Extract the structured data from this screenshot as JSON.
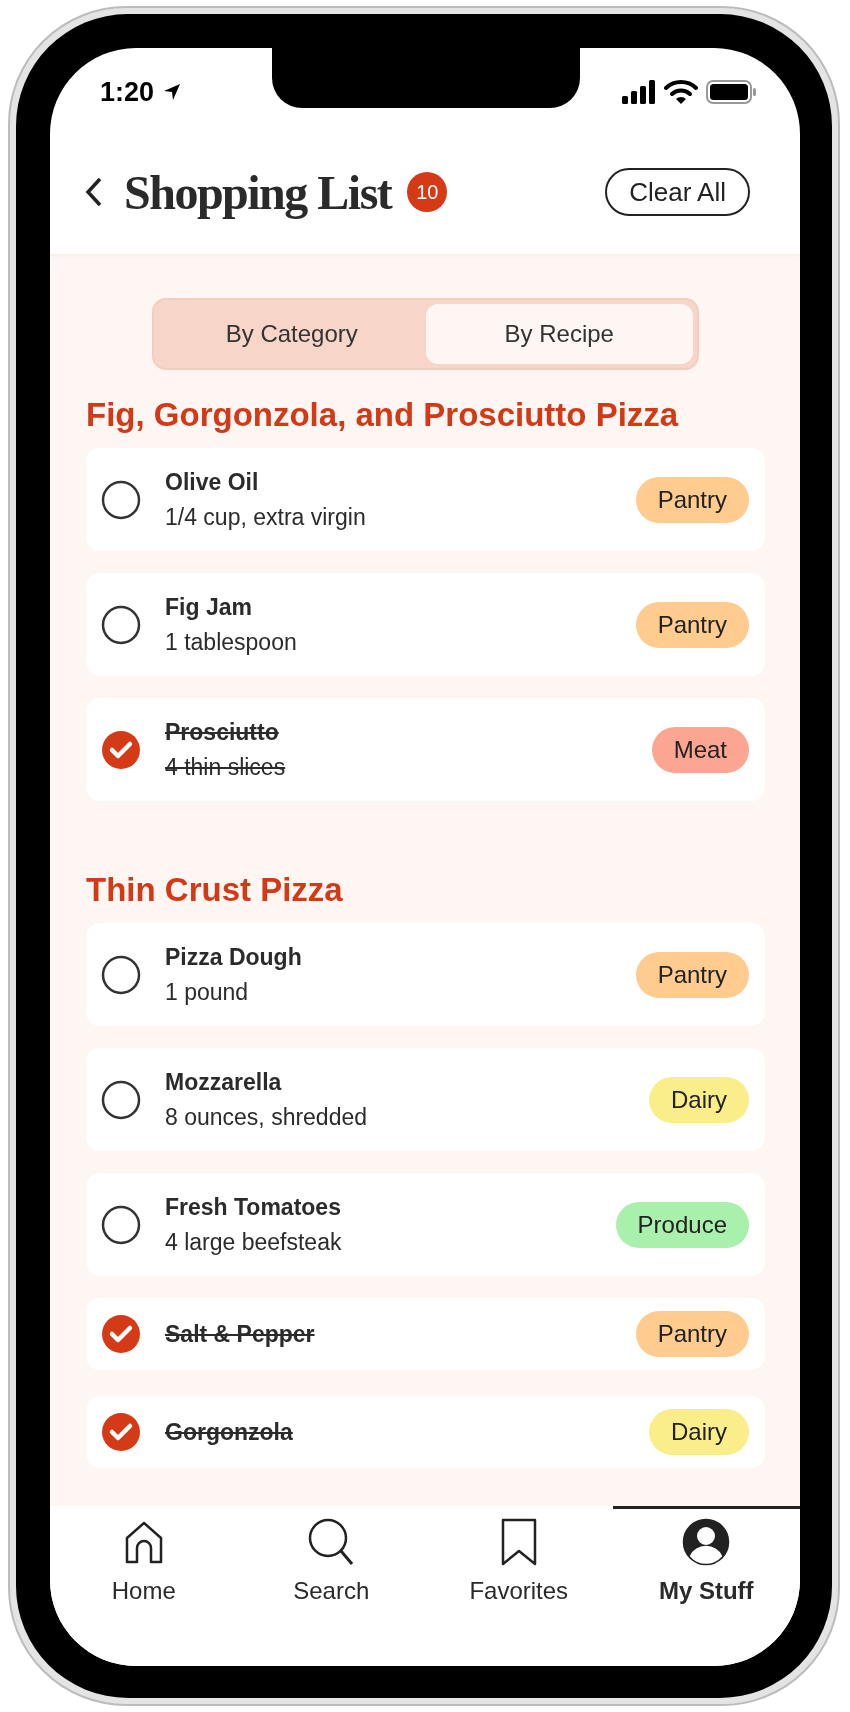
{
  "status_bar": {
    "time": "1:20"
  },
  "header": {
    "title": "Shopping List",
    "count": "10",
    "action": "Clear All"
  },
  "view_tabs": [
    {
      "label": "By Category",
      "selected": false
    },
    {
      "label": "By Recipe",
      "selected": true
    }
  ],
  "sections": [
    {
      "title": "Fig, Gorgonzola, and Prosciutto Pizza",
      "items": [
        {
          "name": "Olive Oil",
          "detail": "1/4 cup, extra virgin",
          "tag": "Pantry",
          "color": "#ffcb8e",
          "checked": false
        },
        {
          "name": "Fig Jam",
          "detail": "1 tablespoon",
          "tag": "Pantry",
          "color": "#ffcb8e",
          "checked": false
        },
        {
          "name": "Prosciutto",
          "detail": "4 thin slices",
          "tag": "Meat",
          "color": "#fca592",
          "checked": true
        }
      ]
    },
    {
      "title": "Thin Crust Pizza",
      "items": [
        {
          "name": "Pizza Dough",
          "detail": "1 pound",
          "tag": "Pantry",
          "color": "#ffcb8e",
          "checked": false
        },
        {
          "name": "Mozzarella",
          "detail": "8 ounces, shredded",
          "tag": "Dairy",
          "color": "#f9ee8a",
          "checked": false
        },
        {
          "name": "Fresh Tomatoes",
          "detail": "4 large beefsteak",
          "tag": "Produce",
          "color": "#a8f0ab",
          "checked": false
        },
        {
          "name": "Salt & Pepper",
          "tag": "Pantry",
          "color": "#ffcb8e",
          "checked": true
        },
        {
          "name": "Gorgonzola",
          "tag": "Dairy",
          "color": "#f9ee8a",
          "checked": true
        }
      ]
    }
  ],
  "nav": [
    {
      "label": "Home",
      "selected": false
    },
    {
      "label": "Search",
      "selected": false
    },
    {
      "label": "Favorites",
      "selected": false
    },
    {
      "label": "My Stuff",
      "selected": true
    }
  ]
}
